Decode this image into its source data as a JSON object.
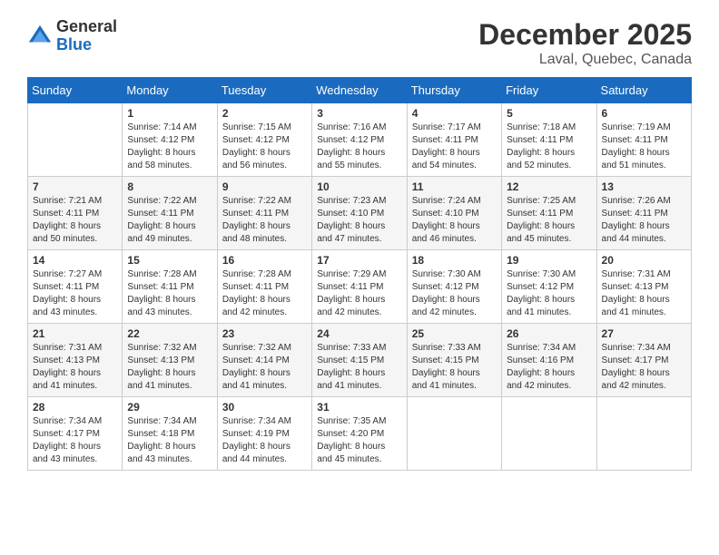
{
  "header": {
    "logo_general": "General",
    "logo_blue": "Blue",
    "month": "December 2025",
    "location": "Laval, Quebec, Canada"
  },
  "weekdays": [
    "Sunday",
    "Monday",
    "Tuesday",
    "Wednesday",
    "Thursday",
    "Friday",
    "Saturday"
  ],
  "weeks": [
    [
      {
        "day": "",
        "sunrise": "",
        "sunset": "",
        "daylight": ""
      },
      {
        "day": "1",
        "sunrise": "Sunrise: 7:14 AM",
        "sunset": "Sunset: 4:12 PM",
        "daylight": "Daylight: 8 hours and 58 minutes."
      },
      {
        "day": "2",
        "sunrise": "Sunrise: 7:15 AM",
        "sunset": "Sunset: 4:12 PM",
        "daylight": "Daylight: 8 hours and 56 minutes."
      },
      {
        "day": "3",
        "sunrise": "Sunrise: 7:16 AM",
        "sunset": "Sunset: 4:12 PM",
        "daylight": "Daylight: 8 hours and 55 minutes."
      },
      {
        "day": "4",
        "sunrise": "Sunrise: 7:17 AM",
        "sunset": "Sunset: 4:11 PM",
        "daylight": "Daylight: 8 hours and 54 minutes."
      },
      {
        "day": "5",
        "sunrise": "Sunrise: 7:18 AM",
        "sunset": "Sunset: 4:11 PM",
        "daylight": "Daylight: 8 hours and 52 minutes."
      },
      {
        "day": "6",
        "sunrise": "Sunrise: 7:19 AM",
        "sunset": "Sunset: 4:11 PM",
        "daylight": "Daylight: 8 hours and 51 minutes."
      }
    ],
    [
      {
        "day": "7",
        "sunrise": "Sunrise: 7:21 AM",
        "sunset": "Sunset: 4:11 PM",
        "daylight": "Daylight: 8 hours and 50 minutes."
      },
      {
        "day": "8",
        "sunrise": "Sunrise: 7:22 AM",
        "sunset": "Sunset: 4:11 PM",
        "daylight": "Daylight: 8 hours and 49 minutes."
      },
      {
        "day": "9",
        "sunrise": "Sunrise: 7:22 AM",
        "sunset": "Sunset: 4:11 PM",
        "daylight": "Daylight: 8 hours and 48 minutes."
      },
      {
        "day": "10",
        "sunrise": "Sunrise: 7:23 AM",
        "sunset": "Sunset: 4:10 PM",
        "daylight": "Daylight: 8 hours and 47 minutes."
      },
      {
        "day": "11",
        "sunrise": "Sunrise: 7:24 AM",
        "sunset": "Sunset: 4:10 PM",
        "daylight": "Daylight: 8 hours and 46 minutes."
      },
      {
        "day": "12",
        "sunrise": "Sunrise: 7:25 AM",
        "sunset": "Sunset: 4:11 PM",
        "daylight": "Daylight: 8 hours and 45 minutes."
      },
      {
        "day": "13",
        "sunrise": "Sunrise: 7:26 AM",
        "sunset": "Sunset: 4:11 PM",
        "daylight": "Daylight: 8 hours and 44 minutes."
      }
    ],
    [
      {
        "day": "14",
        "sunrise": "Sunrise: 7:27 AM",
        "sunset": "Sunset: 4:11 PM",
        "daylight": "Daylight: 8 hours and 43 minutes."
      },
      {
        "day": "15",
        "sunrise": "Sunrise: 7:28 AM",
        "sunset": "Sunset: 4:11 PM",
        "daylight": "Daylight: 8 hours and 43 minutes."
      },
      {
        "day": "16",
        "sunrise": "Sunrise: 7:28 AM",
        "sunset": "Sunset: 4:11 PM",
        "daylight": "Daylight: 8 hours and 42 minutes."
      },
      {
        "day": "17",
        "sunrise": "Sunrise: 7:29 AM",
        "sunset": "Sunset: 4:11 PM",
        "daylight": "Daylight: 8 hours and 42 minutes."
      },
      {
        "day": "18",
        "sunrise": "Sunrise: 7:30 AM",
        "sunset": "Sunset: 4:12 PM",
        "daylight": "Daylight: 8 hours and 42 minutes."
      },
      {
        "day": "19",
        "sunrise": "Sunrise: 7:30 AM",
        "sunset": "Sunset: 4:12 PM",
        "daylight": "Daylight: 8 hours and 41 minutes."
      },
      {
        "day": "20",
        "sunrise": "Sunrise: 7:31 AM",
        "sunset": "Sunset: 4:13 PM",
        "daylight": "Daylight: 8 hours and 41 minutes."
      }
    ],
    [
      {
        "day": "21",
        "sunrise": "Sunrise: 7:31 AM",
        "sunset": "Sunset: 4:13 PM",
        "daylight": "Daylight: 8 hours and 41 minutes."
      },
      {
        "day": "22",
        "sunrise": "Sunrise: 7:32 AM",
        "sunset": "Sunset: 4:13 PM",
        "daylight": "Daylight: 8 hours and 41 minutes."
      },
      {
        "day": "23",
        "sunrise": "Sunrise: 7:32 AM",
        "sunset": "Sunset: 4:14 PM",
        "daylight": "Daylight: 8 hours and 41 minutes."
      },
      {
        "day": "24",
        "sunrise": "Sunrise: 7:33 AM",
        "sunset": "Sunset: 4:15 PM",
        "daylight": "Daylight: 8 hours and 41 minutes."
      },
      {
        "day": "25",
        "sunrise": "Sunrise: 7:33 AM",
        "sunset": "Sunset: 4:15 PM",
        "daylight": "Daylight: 8 hours and 41 minutes."
      },
      {
        "day": "26",
        "sunrise": "Sunrise: 7:34 AM",
        "sunset": "Sunset: 4:16 PM",
        "daylight": "Daylight: 8 hours and 42 minutes."
      },
      {
        "day": "27",
        "sunrise": "Sunrise: 7:34 AM",
        "sunset": "Sunset: 4:17 PM",
        "daylight": "Daylight: 8 hours and 42 minutes."
      }
    ],
    [
      {
        "day": "28",
        "sunrise": "Sunrise: 7:34 AM",
        "sunset": "Sunset: 4:17 PM",
        "daylight": "Daylight: 8 hours and 43 minutes."
      },
      {
        "day": "29",
        "sunrise": "Sunrise: 7:34 AM",
        "sunset": "Sunset: 4:18 PM",
        "daylight": "Daylight: 8 hours and 43 minutes."
      },
      {
        "day": "30",
        "sunrise": "Sunrise: 7:34 AM",
        "sunset": "Sunset: 4:19 PM",
        "daylight": "Daylight: 8 hours and 44 minutes."
      },
      {
        "day": "31",
        "sunrise": "Sunrise: 7:35 AM",
        "sunset": "Sunset: 4:20 PM",
        "daylight": "Daylight: 8 hours and 45 minutes."
      },
      {
        "day": "",
        "sunrise": "",
        "sunset": "",
        "daylight": ""
      },
      {
        "day": "",
        "sunrise": "",
        "sunset": "",
        "daylight": ""
      },
      {
        "day": "",
        "sunrise": "",
        "sunset": "",
        "daylight": ""
      }
    ]
  ]
}
